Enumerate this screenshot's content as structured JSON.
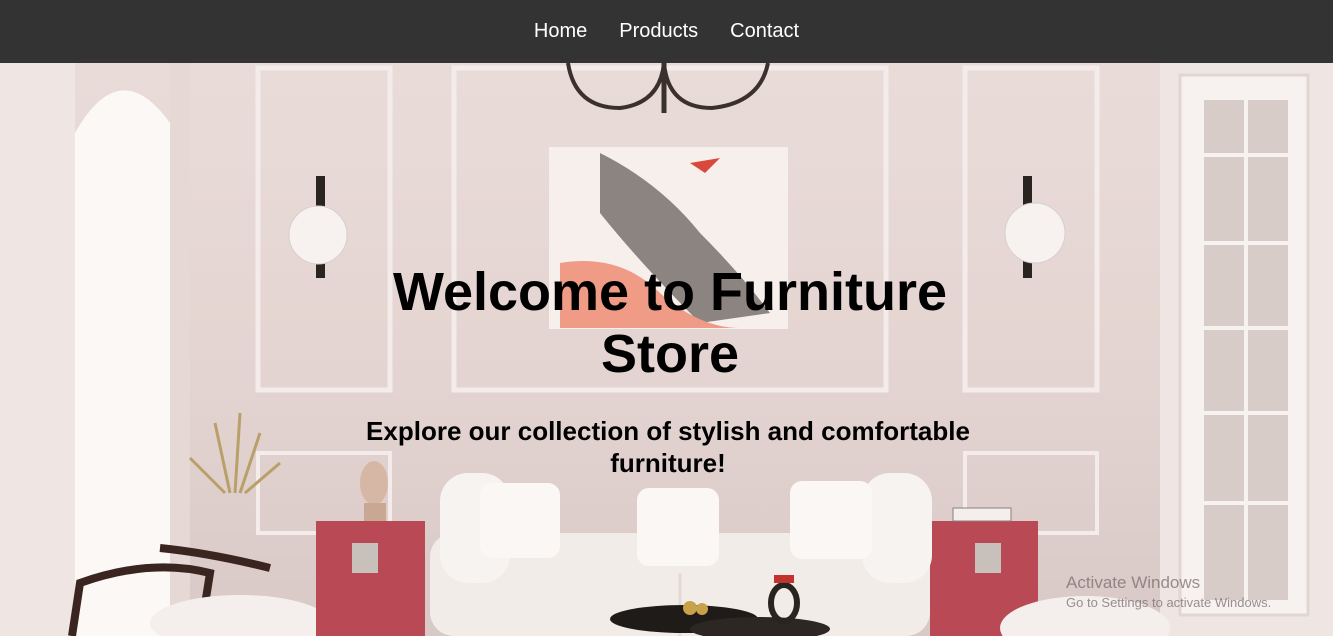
{
  "nav": {
    "items": [
      {
        "label": "Home"
      },
      {
        "label": "Products"
      },
      {
        "label": "Contact"
      }
    ]
  },
  "hero": {
    "title": "Welcome to Furniture Store",
    "subtitle": "Explore our collection of stylish and comfortable furniture!"
  },
  "watermark": {
    "title": "Activate Windows",
    "subtitle": "Go to Settings to activate Windows."
  },
  "colors": {
    "navbar": "#333333",
    "nav_text": "#ffffff",
    "hero_text": "#000000"
  }
}
